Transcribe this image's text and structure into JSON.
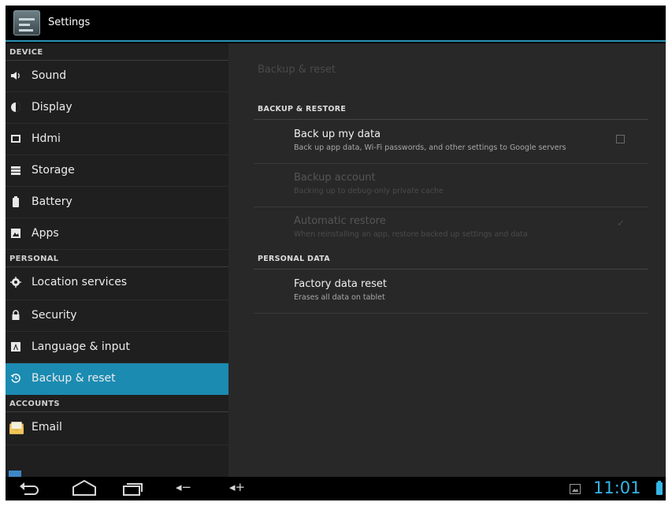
{
  "actionbar": {
    "title": "Settings",
    "icon": "settings-app-icon"
  },
  "sidebar": {
    "sections": [
      {
        "header": "DEVICE",
        "items": [
          {
            "label": "Sound",
            "icon": "speaker-icon"
          },
          {
            "label": "Display",
            "icon": "brightness-icon"
          },
          {
            "label": "Hdmi",
            "icon": "monitor-icon"
          },
          {
            "label": "Storage",
            "icon": "storage-icon"
          },
          {
            "label": "Battery",
            "icon": "battery-icon"
          },
          {
            "label": "Apps",
            "icon": "apps-icon"
          }
        ]
      },
      {
        "header": "PERSONAL",
        "items": [
          {
            "label": "Location services",
            "icon": "location-icon"
          },
          {
            "label": "Security",
            "icon": "lock-icon"
          },
          {
            "label": "Language & input",
            "icon": "keyboard-icon"
          },
          {
            "label": "Backup & reset",
            "icon": "restore-icon",
            "active": true
          }
        ]
      },
      {
        "header": "ACCOUNTS",
        "items": [
          {
            "label": "Email",
            "icon": "email-icon"
          }
        ]
      }
    ]
  },
  "content": {
    "heading": "Backup & reset",
    "backup_header": "BACKUP & RESTORE",
    "personal_header": "PERSONAL DATA",
    "backup_my_data": {
      "title": "Back up my data",
      "summary": "Back up app data, Wi-Fi passwords, and other settings to Google servers",
      "checked": false
    },
    "backup_account": {
      "title": "Backup account",
      "summary": "Backing up to debug-only private cache",
      "enabled": false
    },
    "automatic_restore": {
      "title": "Automatic restore",
      "summary": "When reinstalling an app, restore backed up settings and data",
      "checked": true,
      "enabled": false
    },
    "factory_reset": {
      "title": "Factory data reset",
      "summary": "Erases all data on tablet"
    }
  },
  "navbar": {
    "buttons": [
      "back-icon",
      "home-icon",
      "recent-apps-icon",
      "volume-down-icon",
      "volume-up-icon"
    ],
    "vol_down_label": "◂−",
    "vol_up_label": "◂+",
    "time": "11:01"
  },
  "colors": {
    "accent": "#1b8bb2",
    "clock": "#35b6e5",
    "content_bg": "#282828",
    "sidebar_bg": "#1f1f1f"
  }
}
